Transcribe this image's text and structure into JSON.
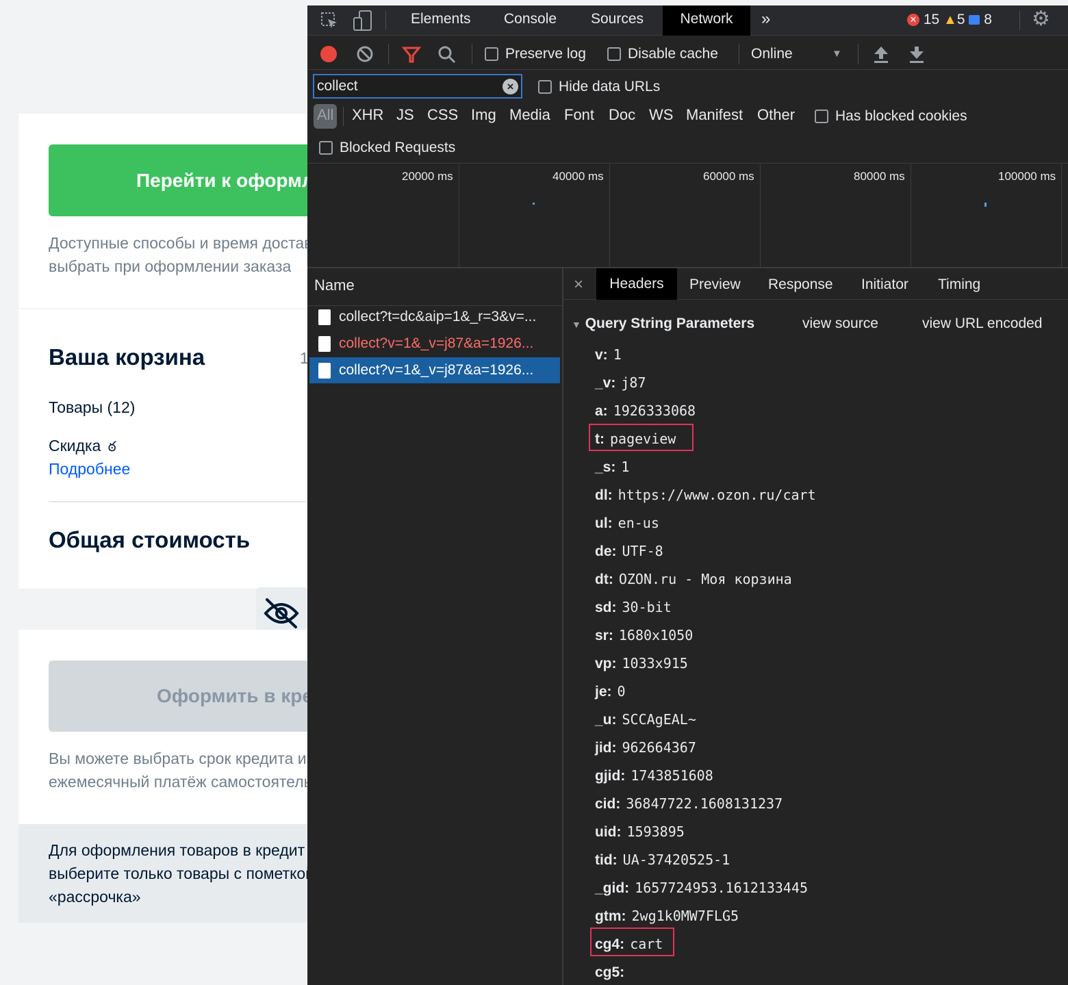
{
  "left_page": {
    "checkout_button": "Перейти к оформлению",
    "delivery_note_line1": "Доступные способы и время доставки можно",
    "delivery_note_line2": "выбрать при оформлении заказа",
    "cart_title": "Ваша корзина",
    "cart_count": "1",
    "goods": "Товары (12)",
    "discount": "Скидка",
    "more_link": "Подробнее",
    "total_title": "Общая стоимость",
    "credit_button": "Оформить в кредит",
    "credit_note_line1": "Вы можете выбрать срок кредита и",
    "credit_note_line2": "ежемесячный платёж самостоятельно",
    "installment_line1": "Для оформления товаров в кредит",
    "installment_line2": "выберите только товары с пометкой",
    "installment_line3": "«рассрочка»"
  },
  "devtools": {
    "tabs": [
      "Elements",
      "Console",
      "Sources",
      "Network"
    ],
    "active_tab": "Network",
    "more_tabs": "»",
    "errors": "15",
    "warnings": "5",
    "messages": "8",
    "toolbar": {
      "preserve_log": "Preserve log",
      "disable_cache": "Disable cache",
      "throttling": "Online"
    },
    "filter_value": "collect",
    "hide_data_urls": "Hide data URLs",
    "type_filters": [
      "All",
      "XHR",
      "JS",
      "CSS",
      "Img",
      "Media",
      "Font",
      "Doc",
      "WS",
      "Manifest",
      "Other"
    ],
    "has_blocked_cookies": "Has blocked cookies",
    "blocked_requests": "Blocked Requests",
    "timeline_ticks": [
      "20000 ms",
      "40000 ms",
      "60000 ms",
      "80000 ms",
      "100000 ms"
    ],
    "name_header": "Name",
    "requests": [
      {
        "name": "collect?t=dc&aip=1&_r=3&v=..."
      },
      {
        "name": "collect?v=1&_v=j87&a=1926..."
      },
      {
        "name": "collect?v=1&_v=j87&a=1926..."
      }
    ],
    "detail_tabs": [
      "Headers",
      "Preview",
      "Response",
      "Initiator",
      "Timing"
    ],
    "active_detail_tab": "Headers",
    "close_symbol": "×",
    "section_title": "Query String Parameters",
    "view_source": "view source",
    "view_url_encoded": "view URL encoded",
    "params": [
      {
        "k": "v:",
        "v": "1"
      },
      {
        "k": "_v:",
        "v": "j87"
      },
      {
        "k": "a:",
        "v": "1926333068"
      },
      {
        "k": "t:",
        "v": "pageview"
      },
      {
        "k": "_s:",
        "v": "1"
      },
      {
        "k": "dl:",
        "v": "https://www.ozon.ru/cart"
      },
      {
        "k": "ul:",
        "v": "en-us"
      },
      {
        "k": "de:",
        "v": "UTF-8"
      },
      {
        "k": "dt:",
        "v": "OZON.ru - Моя корзина"
      },
      {
        "k": "sd:",
        "v": "30-bit"
      },
      {
        "k": "sr:",
        "v": "1680x1050"
      },
      {
        "k": "vp:",
        "v": "1033x915"
      },
      {
        "k": "je:",
        "v": "0"
      },
      {
        "k": "_u:",
        "v": "SCCAgEAL~"
      },
      {
        "k": "jid:",
        "v": "962664367"
      },
      {
        "k": "gjid:",
        "v": "1743851608"
      },
      {
        "k": "cid:",
        "v": "36847722.1608131237"
      },
      {
        "k": "uid:",
        "v": "1593895"
      },
      {
        "k": "tid:",
        "v": "UA-37420525-1"
      },
      {
        "k": "_gid:",
        "v": "1657724953.1612133445"
      },
      {
        "k": "gtm:",
        "v": "2wg1k0MW7FLG5"
      },
      {
        "k": "cg4:",
        "v": "cart"
      },
      {
        "k": "cg5:",
        "v": ""
      }
    ],
    "colors": {
      "bg": "#242424",
      "active_row": "#1a5fa0",
      "error_row_text": "#ff6b6b",
      "highlight": "#e3315a"
    }
  }
}
